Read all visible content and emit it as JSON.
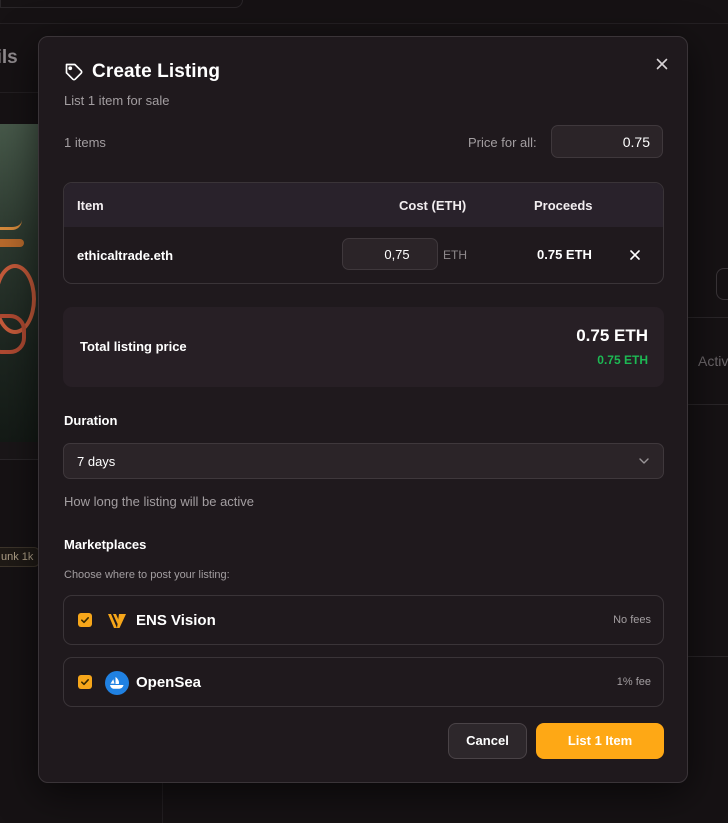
{
  "background": {
    "heading_fragment": "ails",
    "tag_fragment": "unk 1k",
    "right_text_fragment": "Activ"
  },
  "modal": {
    "title": "Create Listing",
    "subtitle": "List 1 item for sale",
    "title_icon": "tag-icon",
    "close_icon": "close-icon"
  },
  "summary": {
    "items_count": "1 items",
    "price_for_all_label": "Price for all:",
    "price_for_all_value": "0.75"
  },
  "table": {
    "headers": {
      "item": "Item",
      "cost": "Cost (ETH)",
      "proceeds": "Proceeds"
    },
    "rows": [
      {
        "item": "ethicaltrade.eth",
        "cost": "0,75",
        "cost_unit": "ETH",
        "proceeds": "0.75 ETH"
      }
    ]
  },
  "total": {
    "label": "Total listing price",
    "value": "0.75 ETH",
    "sub_value": "0.75 ETH"
  },
  "duration": {
    "label": "Duration",
    "selected": "7 days",
    "help": "How long the listing will be active"
  },
  "marketplaces": {
    "label": "Marketplaces",
    "help": "Choose where to post your listing:",
    "items": [
      {
        "name": "ENS Vision",
        "fee": "No fees",
        "checked": true,
        "logo": "ens-vision-logo"
      },
      {
        "name": "OpenSea",
        "fee": "1% fee",
        "checked": true,
        "logo": "opensea-logo"
      }
    ]
  },
  "actions": {
    "cancel": "Cancel",
    "submit": "List 1 Item"
  },
  "colors": {
    "accent": "#fea815",
    "success": "#1db954",
    "modal_bg": "#1f191d",
    "page_bg": "#141113"
  }
}
